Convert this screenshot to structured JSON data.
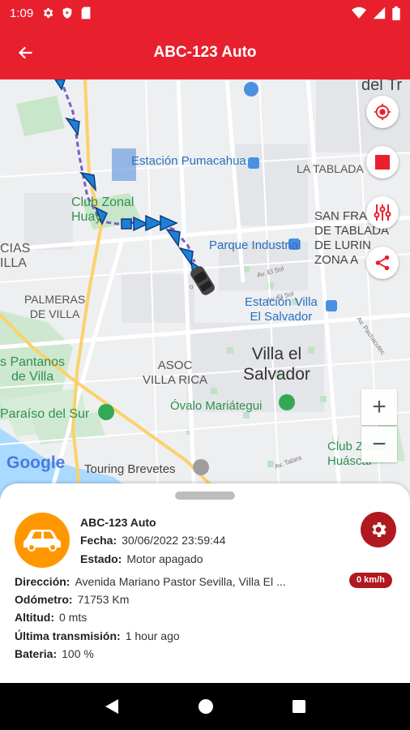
{
  "status_bar": {
    "time": "1:09"
  },
  "app_bar": {
    "title": "ABC-123 Auto"
  },
  "map": {
    "labels": {
      "del_tr": "del Tr",
      "estacion_pumacahua": "Estación Pumacahua",
      "la_tablada": "LA TABLADA",
      "club_zonal_huay": "Club Zonal\nHuay",
      "san_francisco": "SAN FRAN\nDE TABLADA\nDE LURIN\nZONA A",
      "cias_illa": "CIAS\nILLA",
      "parque_industrial": "Parque Industrial",
      "palmeras": "PALMERAS\nDE VILLA",
      "estacion_villa": "Estación Villa\nEl Salvador",
      "pantanos": "s Pantanos\nde Villa",
      "asoc_villa_rica": "ASOC\nVILLA RICA",
      "villa_el_salvador": "Villa el\nSalvador",
      "ovalo": "Óvalo Mariátegui",
      "paraiso": "Paraíso del Sur",
      "club_zonal_huascar": "Club Zonal\nHuáscar",
      "touring": "Touring Brevetes",
      "google": "Google"
    },
    "zoom_in": "+",
    "zoom_out": "−"
  },
  "sheet": {
    "name": "ABC-123 Auto",
    "fecha_label": "Fecha:",
    "fecha_value": "30/06/2022 23:59:44",
    "estado_label": "Estado:",
    "estado_value": "Motor apagado",
    "direccion_label": "Dirección:",
    "direccion_value": "Avenida Mariano Pastor Sevilla, Villa El ...",
    "speed": "0 km/h",
    "odometro_label": "Odómetro:",
    "odometro_value": "71753 Km",
    "altitud_label": "Altitud:",
    "altitud_value": "0 mts",
    "ultima_label": "Última transmisión:",
    "ultima_value": "1 hour ago",
    "bateria_label": "Bateria:",
    "bateria_value": "100 %"
  },
  "colors": {
    "primary": "#e8202e",
    "accent_dark": "#b0191f",
    "car_bg": "#ff9800",
    "route": "#1e7fd8"
  },
  "icons": [
    "settings-icon",
    "play-protect-icon",
    "sim-icon",
    "wifi-icon",
    "signal-icon",
    "battery-icon",
    "back-arrow-icon",
    "locate-icon",
    "stop-icon",
    "filter-icon",
    "share-icon",
    "car-icon",
    "gear-icon",
    "nav-back-icon",
    "nav-home-icon",
    "nav-recents-icon"
  ]
}
